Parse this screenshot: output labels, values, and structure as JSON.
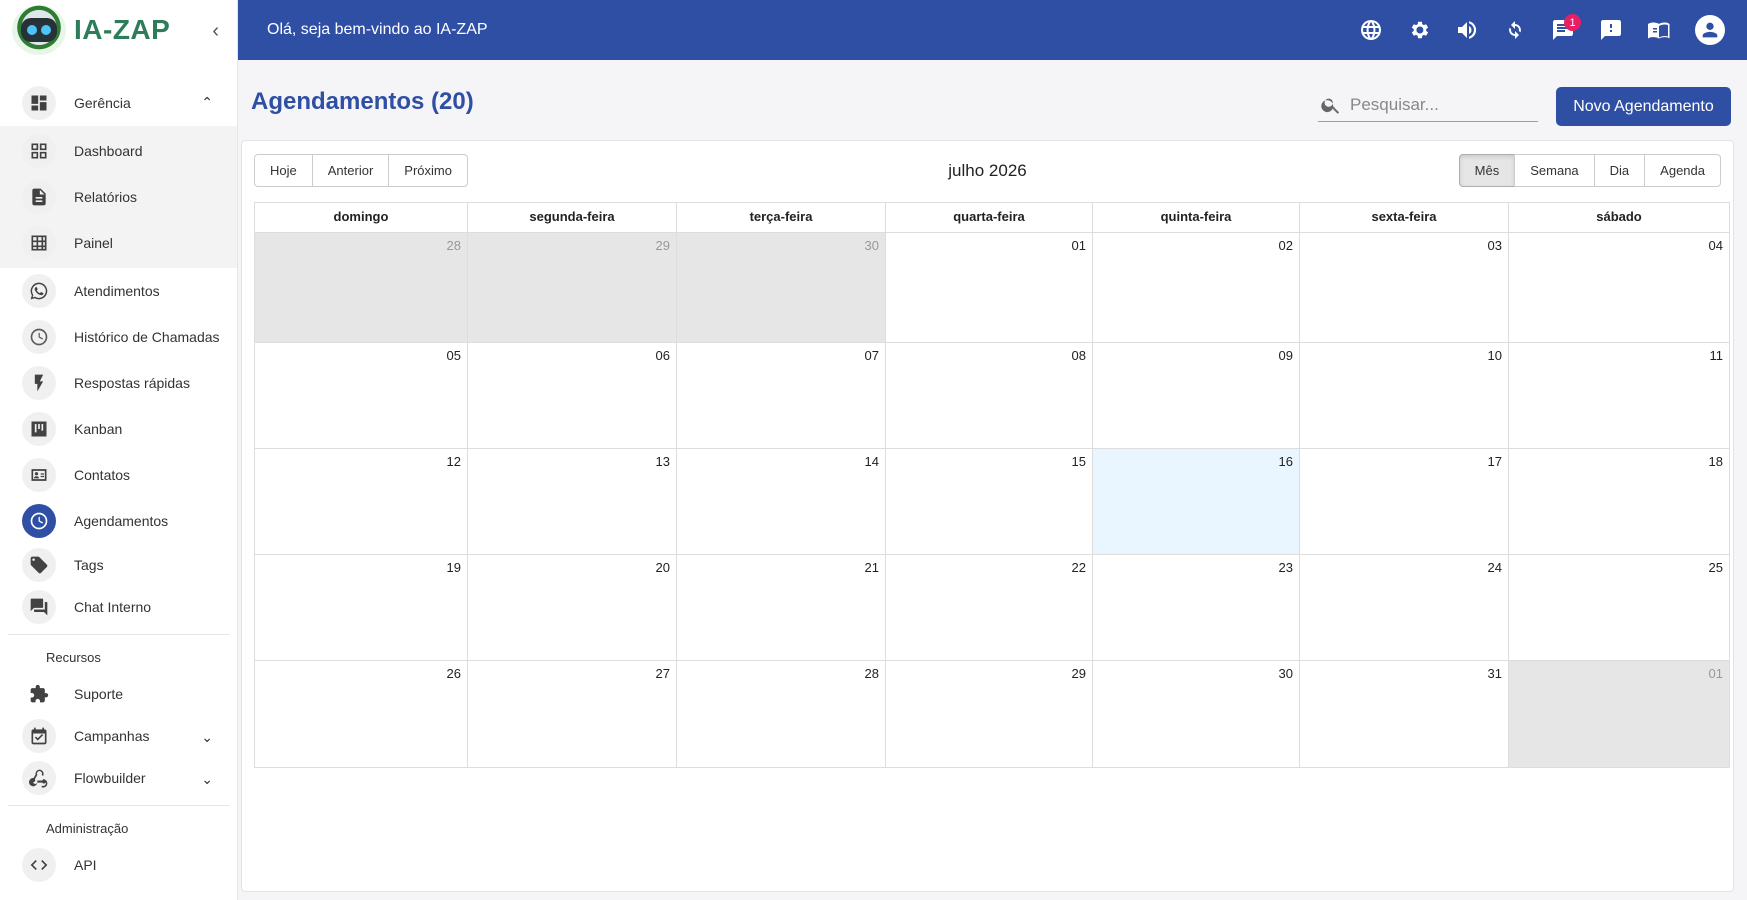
{
  "app": {
    "name": "IA-ZAP",
    "collapse_icon": "chevron-left-icon"
  },
  "header": {
    "greeting": "Olá, seja bem-vindo ao IA-ZAP",
    "icons": [
      "globe-icon",
      "gear-icon",
      "volume-icon",
      "refresh-icon",
      "chat-icon",
      "alert-icon",
      "book-icon",
      "account-icon"
    ],
    "chat_badge": "1"
  },
  "sidebar": {
    "management": {
      "label": "Gerência",
      "icon": "dashboard-icon"
    },
    "sub_items": [
      {
        "label": "Dashboard",
        "icon": "grid-icon"
      },
      {
        "label": "Relatórios",
        "icon": "document-icon"
      },
      {
        "label": "Painel",
        "icon": "table-icon"
      }
    ],
    "items": [
      {
        "label": "Atendimentos",
        "icon": "whatsapp-icon"
      },
      {
        "label": "Histórico de Chamadas",
        "icon": "history-icon"
      },
      {
        "label": "Respostas rápidas",
        "icon": "flash-icon"
      },
      {
        "label": "Kanban",
        "icon": "kanban-icon"
      },
      {
        "label": "Contatos",
        "icon": "contacts-icon"
      },
      {
        "label": "Agendamentos",
        "icon": "clock-icon",
        "active": true
      },
      {
        "label": "Tags",
        "icon": "tag-icon"
      },
      {
        "label": "Chat Interno",
        "icon": "forum-icon"
      }
    ],
    "resources_title": "Recursos",
    "resources": [
      {
        "label": "Suporte",
        "icon": "puzzle-icon"
      },
      {
        "label": "Campanhas",
        "icon": "event-check-icon"
      },
      {
        "label": "Flowbuilder",
        "icon": "webhook-icon"
      }
    ],
    "admin_title": "Administração",
    "admin": [
      {
        "label": "API",
        "icon": "code-icon"
      }
    ]
  },
  "main": {
    "title": "Agendamentos (20)",
    "search_placeholder": "Pesquisar...",
    "new_button": "Novo Agendamento"
  },
  "calendar": {
    "nav": [
      "Hoje",
      "Anterior",
      "Próximo"
    ],
    "month_label": "julho 2026",
    "views": [
      "Mês",
      "Semana",
      "Dia",
      "Agenda"
    ],
    "active_view": "Mês",
    "weekdays": [
      "domingo",
      "segunda-feira",
      "terça-feira",
      "quarta-feira",
      "quinta-feira",
      "sexta-feira",
      "sábado"
    ],
    "weeks": [
      [
        {
          "d": "28",
          "off": true
        },
        {
          "d": "29",
          "off": true
        },
        {
          "d": "30",
          "off": true
        },
        {
          "d": "01"
        },
        {
          "d": "02"
        },
        {
          "d": "03"
        },
        {
          "d": "04"
        }
      ],
      [
        {
          "d": "05"
        },
        {
          "d": "06"
        },
        {
          "d": "07"
        },
        {
          "d": "08"
        },
        {
          "d": "09"
        },
        {
          "d": "10"
        },
        {
          "d": "11"
        }
      ],
      [
        {
          "d": "12"
        },
        {
          "d": "13"
        },
        {
          "d": "14"
        },
        {
          "d": "15"
        },
        {
          "d": "16",
          "today": true
        },
        {
          "d": "17"
        },
        {
          "d": "18"
        }
      ],
      [
        {
          "d": "19"
        },
        {
          "d": "20"
        },
        {
          "d": "21"
        },
        {
          "d": "22"
        },
        {
          "d": "23"
        },
        {
          "d": "24"
        },
        {
          "d": "25"
        }
      ],
      [
        {
          "d": "26"
        },
        {
          "d": "27"
        },
        {
          "d": "28"
        },
        {
          "d": "29"
        },
        {
          "d": "30"
        },
        {
          "d": "31"
        },
        {
          "d": "01",
          "off": true
        }
      ]
    ]
  },
  "colors": {
    "primary": "#2f4fa5",
    "badge": "#e91e63",
    "today": "#eaf6ff",
    "off_range": "#e6e6e6"
  }
}
